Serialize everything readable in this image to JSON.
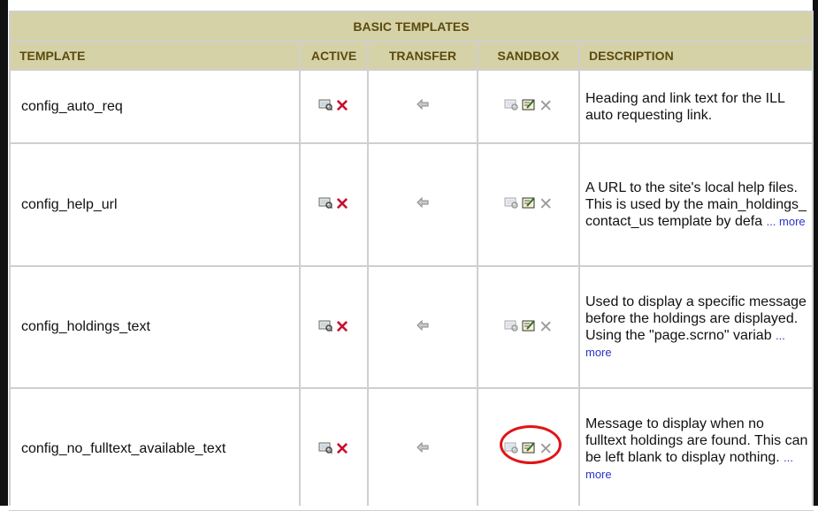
{
  "table": {
    "title": "BASIC TEMPLATES",
    "headers": {
      "template": "TEMPLATE",
      "active": "ACTIVE",
      "transfer": "TRANSFER",
      "sandbox": "SANDBOX",
      "description": "DESCRIPTION"
    },
    "rows": [
      {
        "name": "config_auto_req",
        "desc": "Heading and link text for the ILL auto requesting link.",
        "more": ""
      },
      {
        "name": "config_help_url",
        "desc": "A URL to the site's local help files. This is used by the main_holdings_contact_us template by defa",
        "more": "... more"
      },
      {
        "name": "config_holdings_text",
        "desc": "Used to display a specific message before the holdings are displayed. Using the \"page.scrno\" variab",
        "more": "... more"
      },
      {
        "name": "config_no_fulltext_available_text",
        "desc": "Message to display when no fulltext holdings are found. This can be left blank to display nothing.",
        "more": "... more"
      }
    ]
  },
  "icons": {
    "view": "preview-icon",
    "delete": "delete-x-icon",
    "transfer": "left-arrow-icon",
    "edit": "edit-icon"
  },
  "colors": {
    "header_bg": "#d5d2a8",
    "header_text": "#5c4a0c",
    "delete_red": "#c8102e",
    "highlight_circle": "#e01515",
    "link": "#2a33cc"
  }
}
